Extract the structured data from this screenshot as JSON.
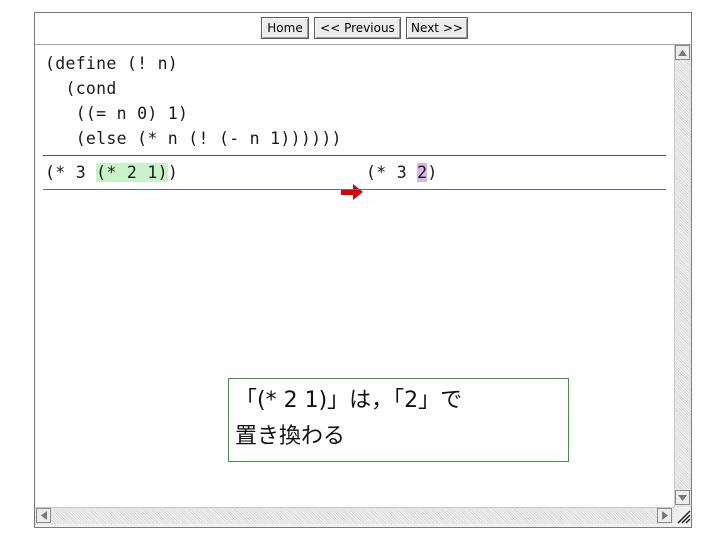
{
  "toolbar": {
    "home_label": "Home",
    "previous_label": "<< Previous",
    "next_label": "Next >>"
  },
  "code": {
    "lines": [
      "(define (! n)",
      "  (cond",
      "   ((= n 0) 1)",
      "   (else (* n (! (- n 1))))))"
    ]
  },
  "reduction": {
    "before_prefix": "(* 3 ",
    "before_highlight": "(* 2 1)",
    "before_suffix": ")",
    "after_prefix": "(* 3 ",
    "after_highlight": "2",
    "after_suffix": ")"
  },
  "note": {
    "line1": "「(* 2 1)」は，「2」で",
    "line2": "置き換わる"
  },
  "colors": {
    "green_highlight": "#c8f2c8",
    "purple_highlight": "#d7b6ea",
    "arrow": "#e00000",
    "rule": "#3d4aa3",
    "note_border": "#339933"
  },
  "icons": {
    "arrow": "red-right-arrow-icon",
    "scroll_up": "scroll-up-icon",
    "scroll_down": "scroll-down-icon",
    "scroll_left": "scroll-left-icon",
    "scroll_right": "scroll-right-icon"
  }
}
